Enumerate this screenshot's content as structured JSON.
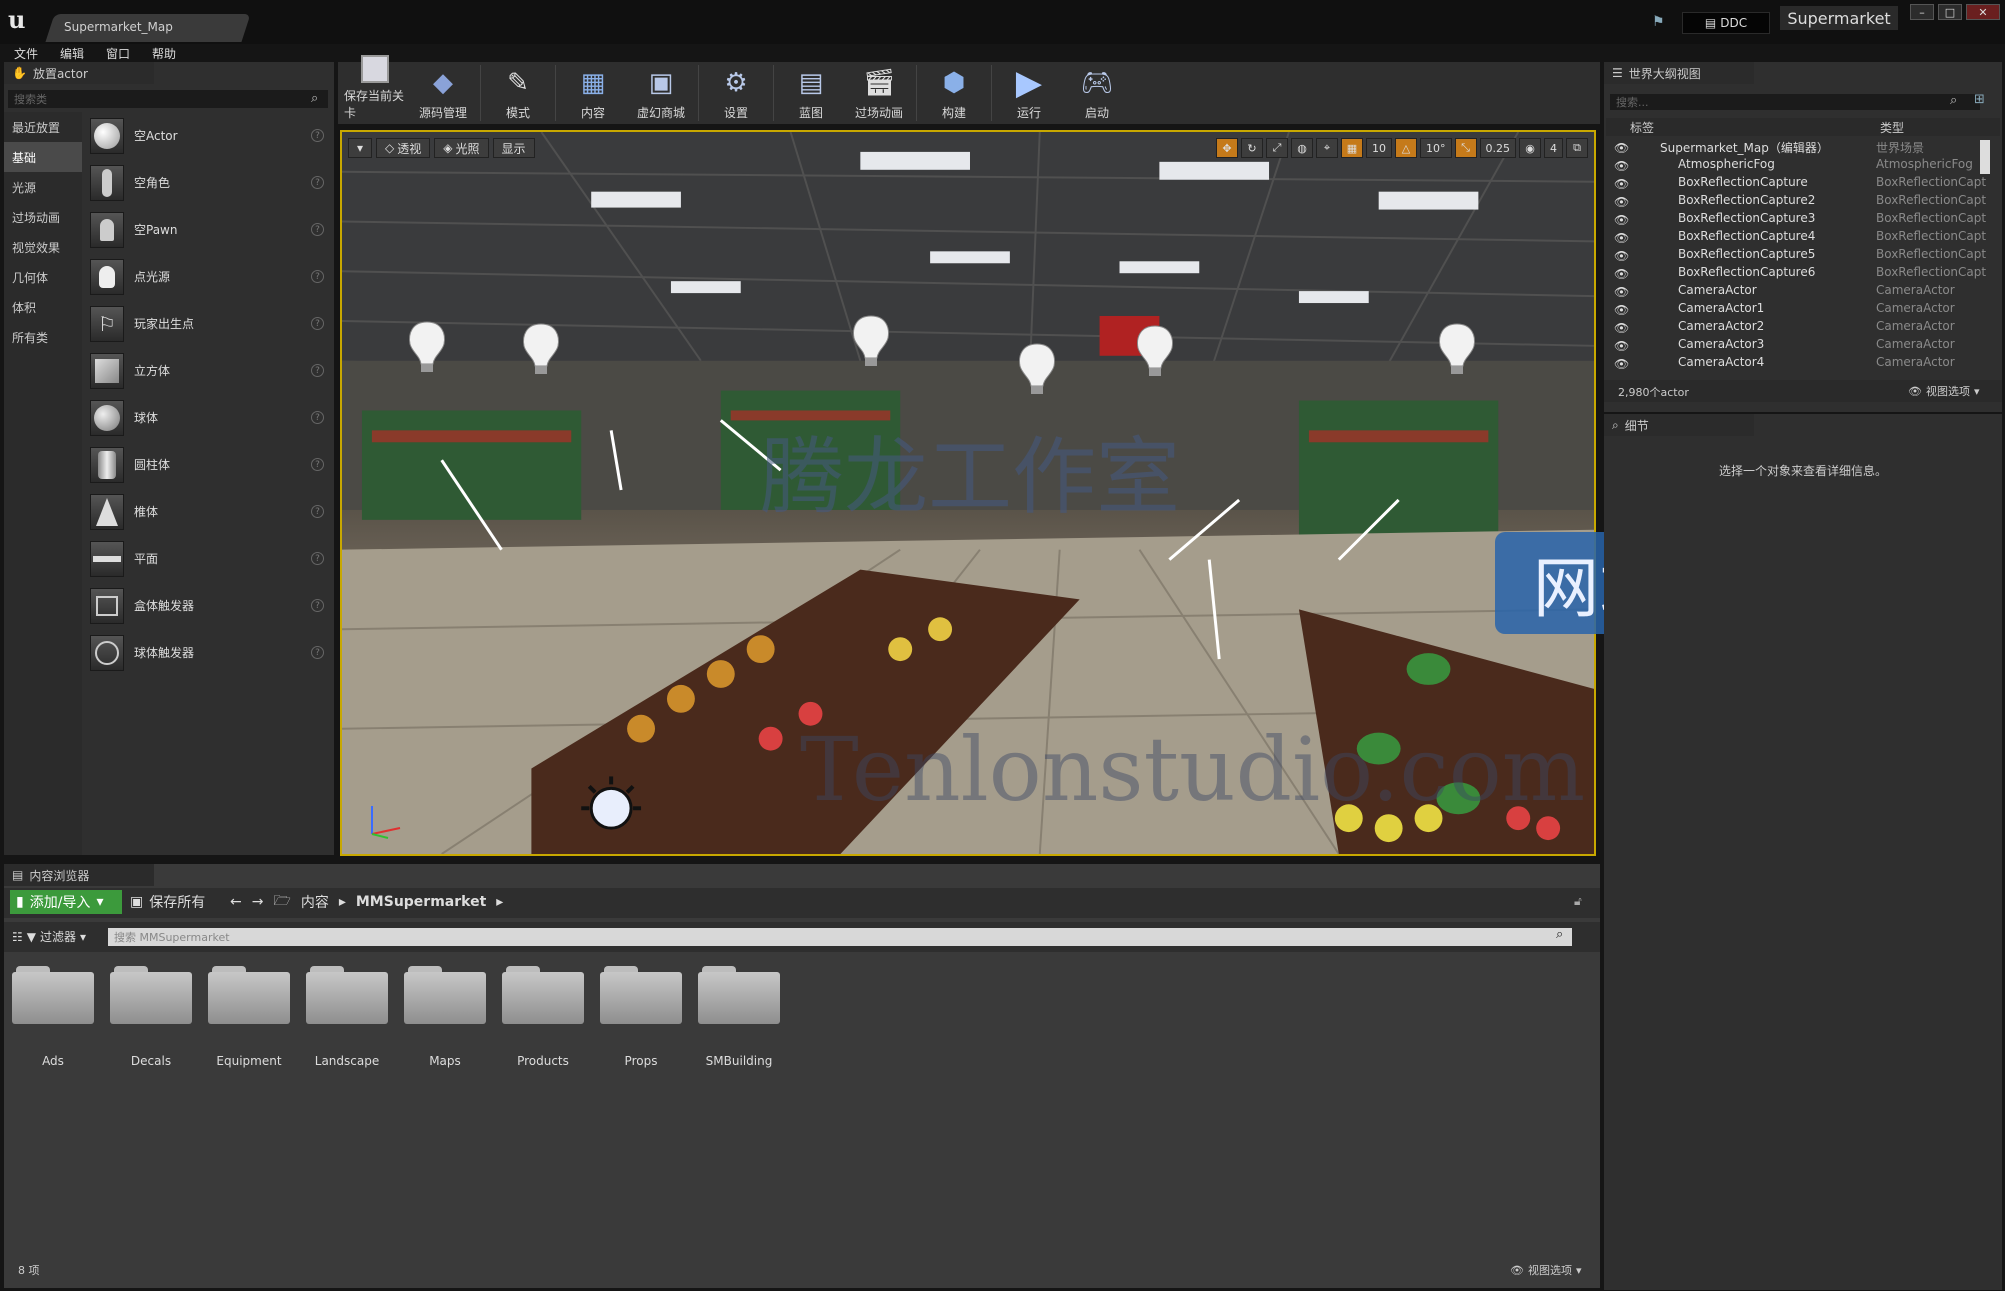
{
  "window": {
    "doc_tab": "Supermarket_Map",
    "ddc": "DDC",
    "project": "Supermarket"
  },
  "menu": [
    "文件",
    "编辑",
    "窗口",
    "帮助"
  ],
  "place_panel": {
    "title": "放置actor",
    "search_placeholder": "搜索类",
    "categories": [
      "最近放置",
      "基础",
      "光源",
      "过场动画",
      "视觉效果",
      "几何体",
      "体积",
      "所有类"
    ],
    "actors": [
      "空Actor",
      "空角色",
      "空Pawn",
      "点光源",
      "玩家出生点",
      "立方体",
      "球体",
      "圆柱体",
      "椎体",
      "平面",
      "盒体触发器",
      "球体触发器"
    ]
  },
  "toolbar": [
    "保存当前关卡",
    "源码管理",
    "模式",
    "内容",
    "虚幻商城",
    "设置",
    "蓝图",
    "过场动画",
    "构建",
    "运行",
    "启动"
  ],
  "viewport": {
    "perspective": "透视",
    "lit": "光照",
    "show": "显示",
    "grid": "10",
    "angle": "10°",
    "scale": "0.25",
    "camera_speed": "4",
    "watermark_cn": "腾龙工作室",
    "watermark_site": "网站",
    "watermark_url": "Tenlonstudio.com"
  },
  "content_browser": {
    "title": "内容浏览器",
    "add_import": "添加/导入",
    "save_all": "保存所有",
    "path_root": "内容",
    "path_folder": "MMSupermarket",
    "filters": "过滤器",
    "search_placeholder": "搜索 MMSupermarket",
    "folders": [
      "Ads",
      "Decals",
      "Equipment",
      "Landscape",
      "Maps",
      "Products",
      "Props",
      "SMBuilding"
    ],
    "item_count": "8 项",
    "view_options": "视图选项"
  },
  "outliner": {
    "title": "世界大纲视图",
    "search_placeholder": "搜索...",
    "col_label": "标签",
    "col_type": "类型",
    "rows": [
      {
        "name": "Supermarket_Map（编辑器）",
        "type": "世界场景"
      },
      {
        "name": "AtmosphericFog",
        "type": "AtmosphericFog"
      },
      {
        "name": "BoxReflectionCapture",
        "type": "BoxReflectionCapt"
      },
      {
        "name": "BoxReflectionCapture2",
        "type": "BoxReflectionCapt"
      },
      {
        "name": "BoxReflectionCapture3",
        "type": "BoxReflectionCapt"
      },
      {
        "name": "BoxReflectionCapture4",
        "type": "BoxReflectionCapt"
      },
      {
        "name": "BoxReflectionCapture5",
        "type": "BoxReflectionCapt"
      },
      {
        "name": "BoxReflectionCapture6",
        "type": "BoxReflectionCapt"
      },
      {
        "name": "CameraActor",
        "type": "CameraActor"
      },
      {
        "name": "CameraActor1",
        "type": "CameraActor"
      },
      {
        "name": "CameraActor2",
        "type": "CameraActor"
      },
      {
        "name": "CameraActor3",
        "type": "CameraActor"
      },
      {
        "name": "CameraActor4",
        "type": "CameraActor"
      }
    ],
    "actor_count": "2,980个actor",
    "view_options": "视图选项"
  },
  "details": {
    "title": "细节",
    "hint": "选择一个对象来查看详细信息。"
  }
}
